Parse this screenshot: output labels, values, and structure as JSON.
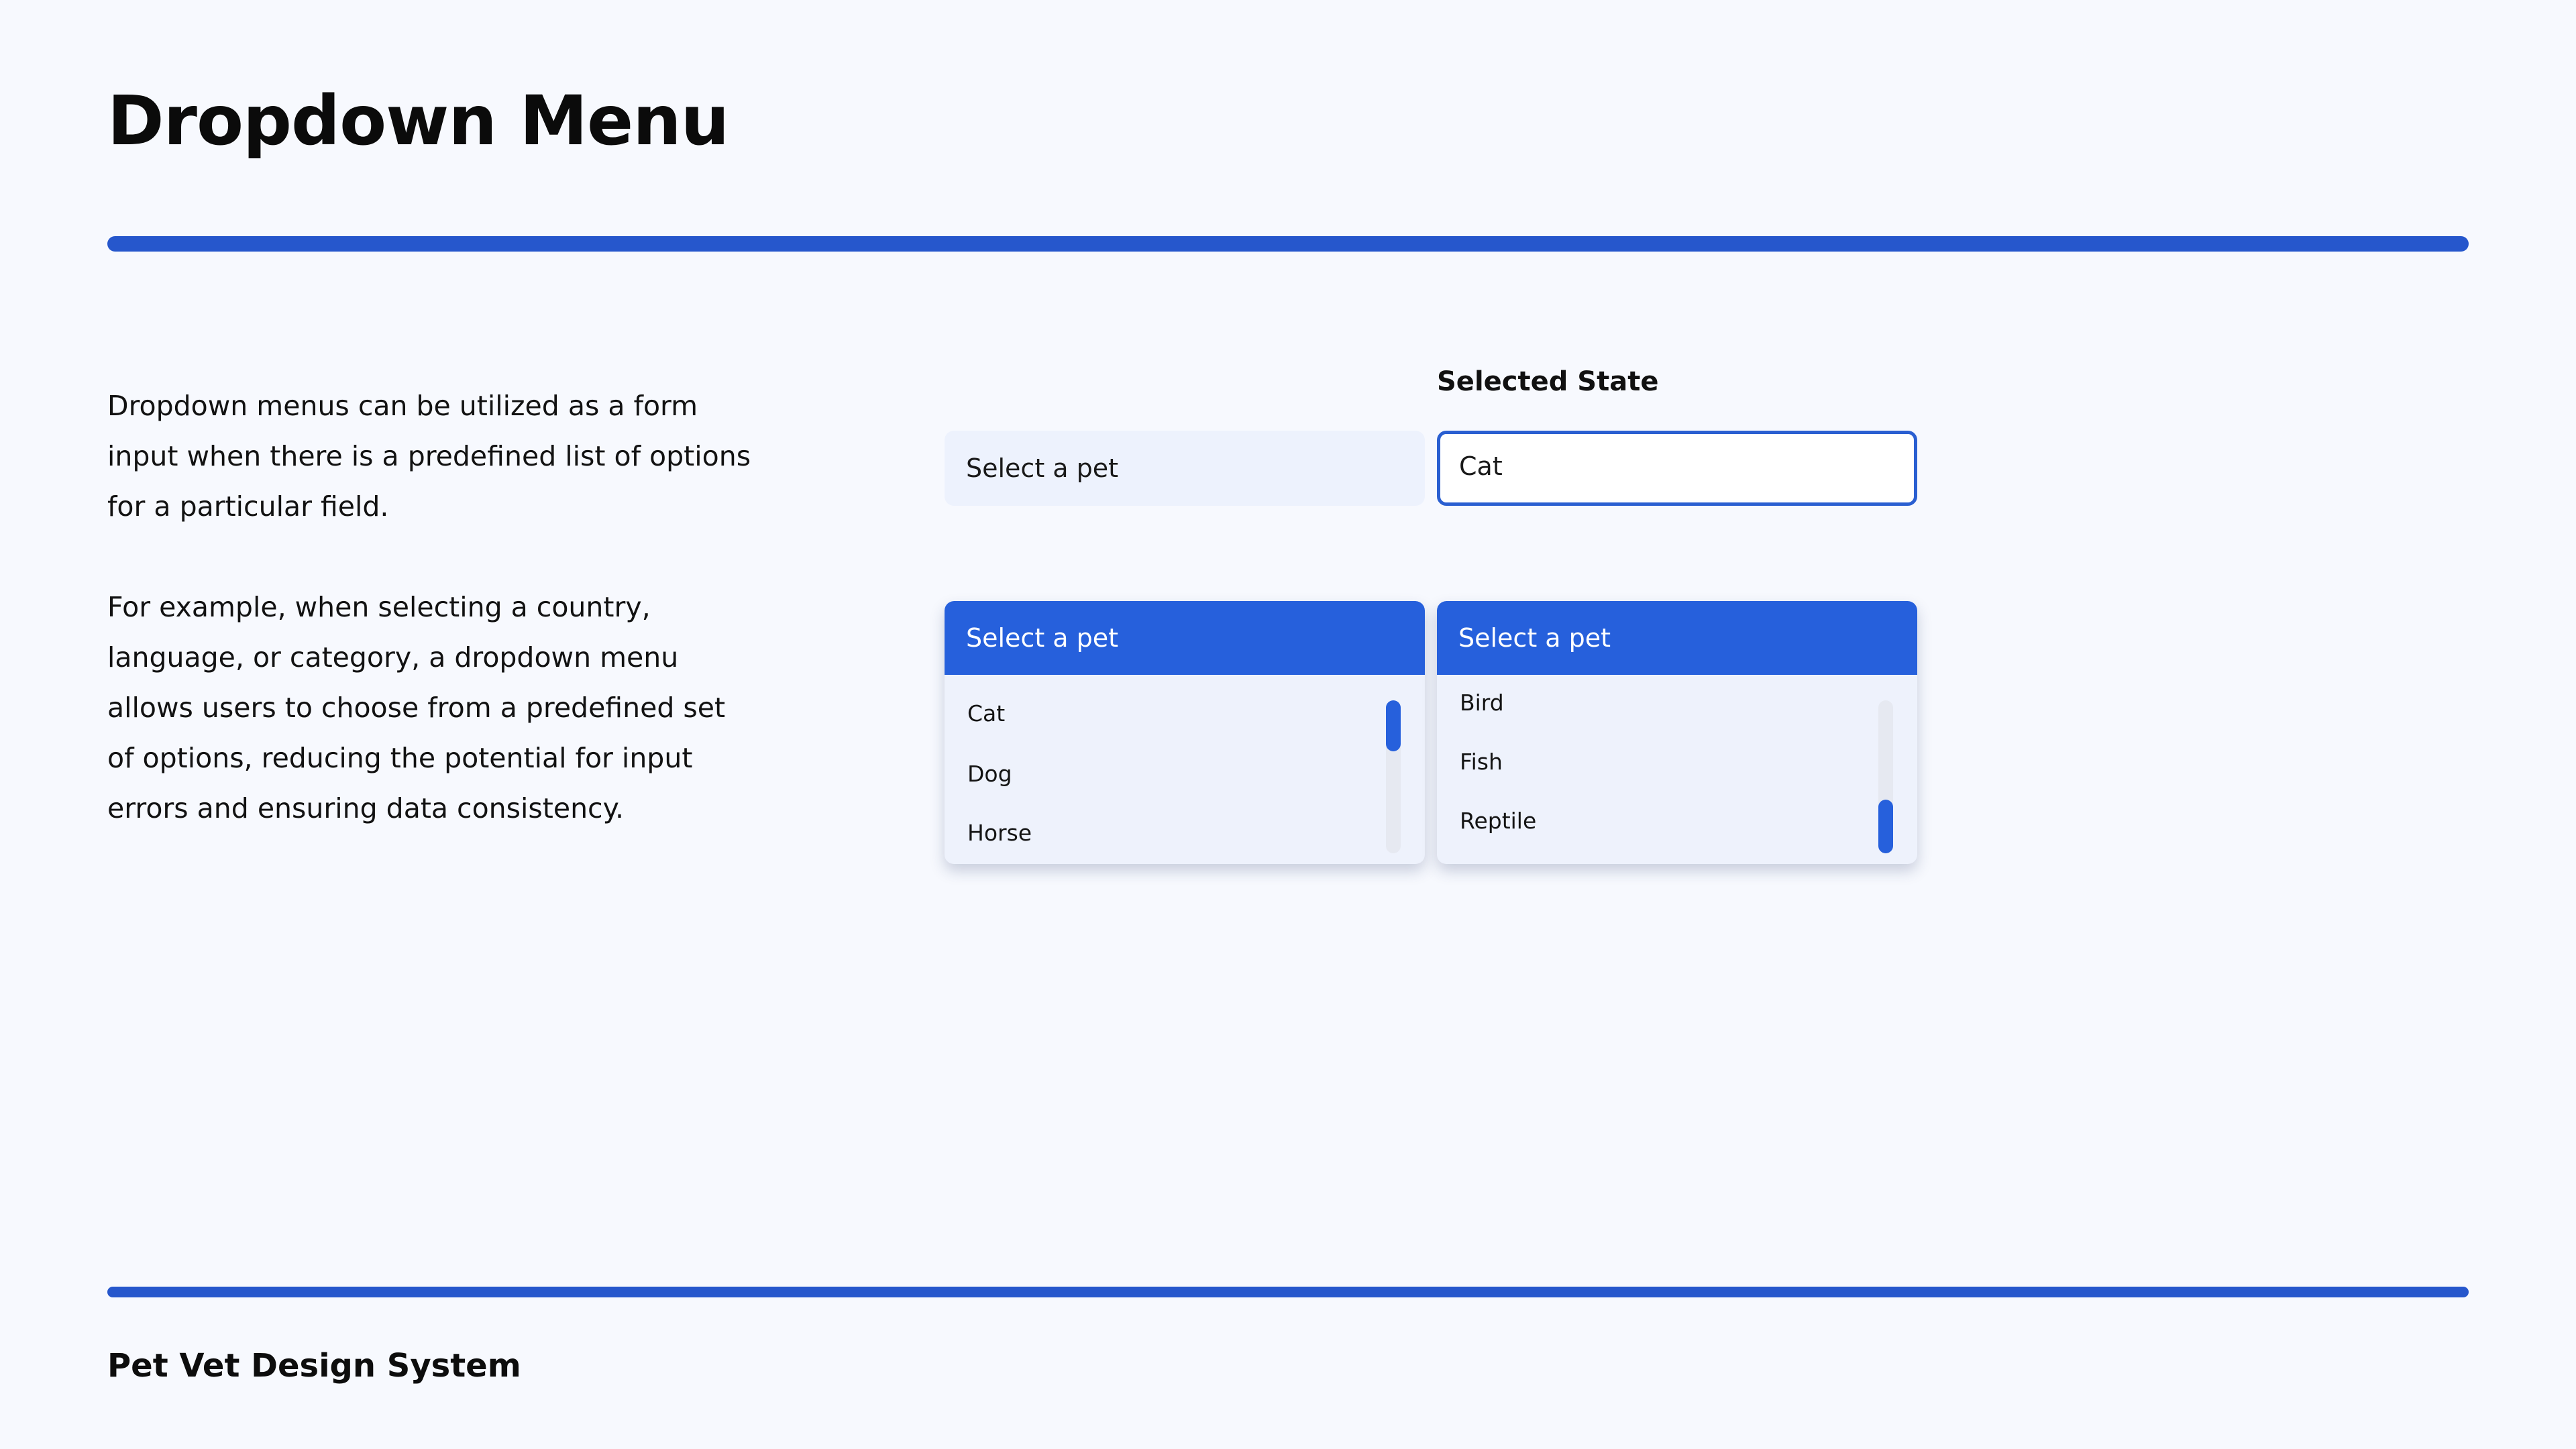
{
  "page": {
    "title": "Dropdown Menu",
    "footer": "Pet Vet Design System"
  },
  "description": {
    "paragraph_1": "Dropdown menus can be utilized as a form input when there is a predefined list of options for a particular field.",
    "paragraph_2": "For example, when selecting a country, language, or category, a dropdown menu allows users to choose from a predefined set of options, reducing the potential for input errors and ensuring data consistency."
  },
  "examples": {
    "selected_state_label": "Selected State",
    "default_field": {
      "placeholder": "Select a pet"
    },
    "selected_field": {
      "value": "Cat"
    },
    "dropdown_top": {
      "header": "Select a pet",
      "options": [
        "Cat",
        "Dog",
        "Horse"
      ],
      "scroll_position": "top"
    },
    "dropdown_bottom": {
      "header": "Select a pet",
      "options": [
        "Bird",
        "Fish",
        "Reptile"
      ],
      "scroll_position": "bottom"
    }
  },
  "colors": {
    "accent": "#2660dc",
    "background": "#f7f9fe",
    "field_background": "#edf2fd",
    "text": "#111111"
  }
}
